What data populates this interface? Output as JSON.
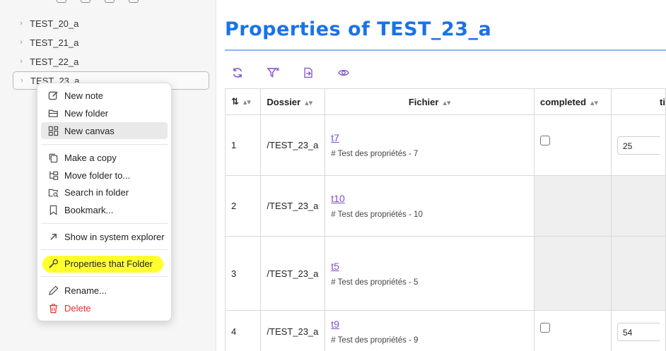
{
  "sidebar": {
    "items": [
      {
        "label": "TEST_20_a"
      },
      {
        "label": "TEST_21_a"
      },
      {
        "label": "TEST_22_a"
      },
      {
        "label": "TEST_23_a"
      }
    ]
  },
  "context_menu": {
    "items": [
      {
        "label": "New note",
        "icon": "edit-icon"
      },
      {
        "label": "New folder",
        "icon": "folder-open-icon"
      },
      {
        "label": "New canvas",
        "icon": "layout-dashboard-icon"
      },
      {
        "label": "Make a copy",
        "icon": "copy-icon"
      },
      {
        "label": "Move folder to...",
        "icon": "folder-tree-icon"
      },
      {
        "label": "Search in folder",
        "icon": "folder-search-icon"
      },
      {
        "label": "Bookmark...",
        "icon": "bookmark-icon"
      },
      {
        "label": "Show in system explorer",
        "icon": "arrow-up-right-icon"
      },
      {
        "label": "Properties that Folder",
        "icon": "wrench-icon"
      },
      {
        "label": "Rename...",
        "icon": "pencil-icon"
      },
      {
        "label": "Delete",
        "icon": "trash-icon"
      }
    ],
    "highlight_color": "#ffff2e",
    "danger_color": "#e03131"
  },
  "main": {
    "title": "Properties of TEST_23_a",
    "title_color": "#1a73e8",
    "toolbar": [
      "refresh-icon",
      "filter-clear-icon",
      "file-export-icon",
      "eye-icon"
    ],
    "table": {
      "headers": [
        "",
        "Dossier",
        "Fichier",
        "completed",
        "ti"
      ],
      "rows": [
        {
          "num": "1",
          "dossier": "/TEST_23_a",
          "file": "t7",
          "sub": "# Test des propriétés - 7",
          "completed": "checkbox",
          "ti": "25"
        },
        {
          "num": "2",
          "dossier": "/TEST_23_a",
          "file": "t10",
          "sub": "# Test des propriétés - 10",
          "completed": "",
          "ti": ""
        },
        {
          "num": "3",
          "dossier": "/TEST_23_a",
          "file": "t5",
          "sub": "# Test des propriétés - 5",
          "completed": "",
          "ti": ""
        },
        {
          "num": "4",
          "dossier": "/TEST_23_a",
          "file": "t9",
          "sub": "# Test des propriétés - 9",
          "completed": "checkbox",
          "ti": "54"
        }
      ]
    }
  }
}
